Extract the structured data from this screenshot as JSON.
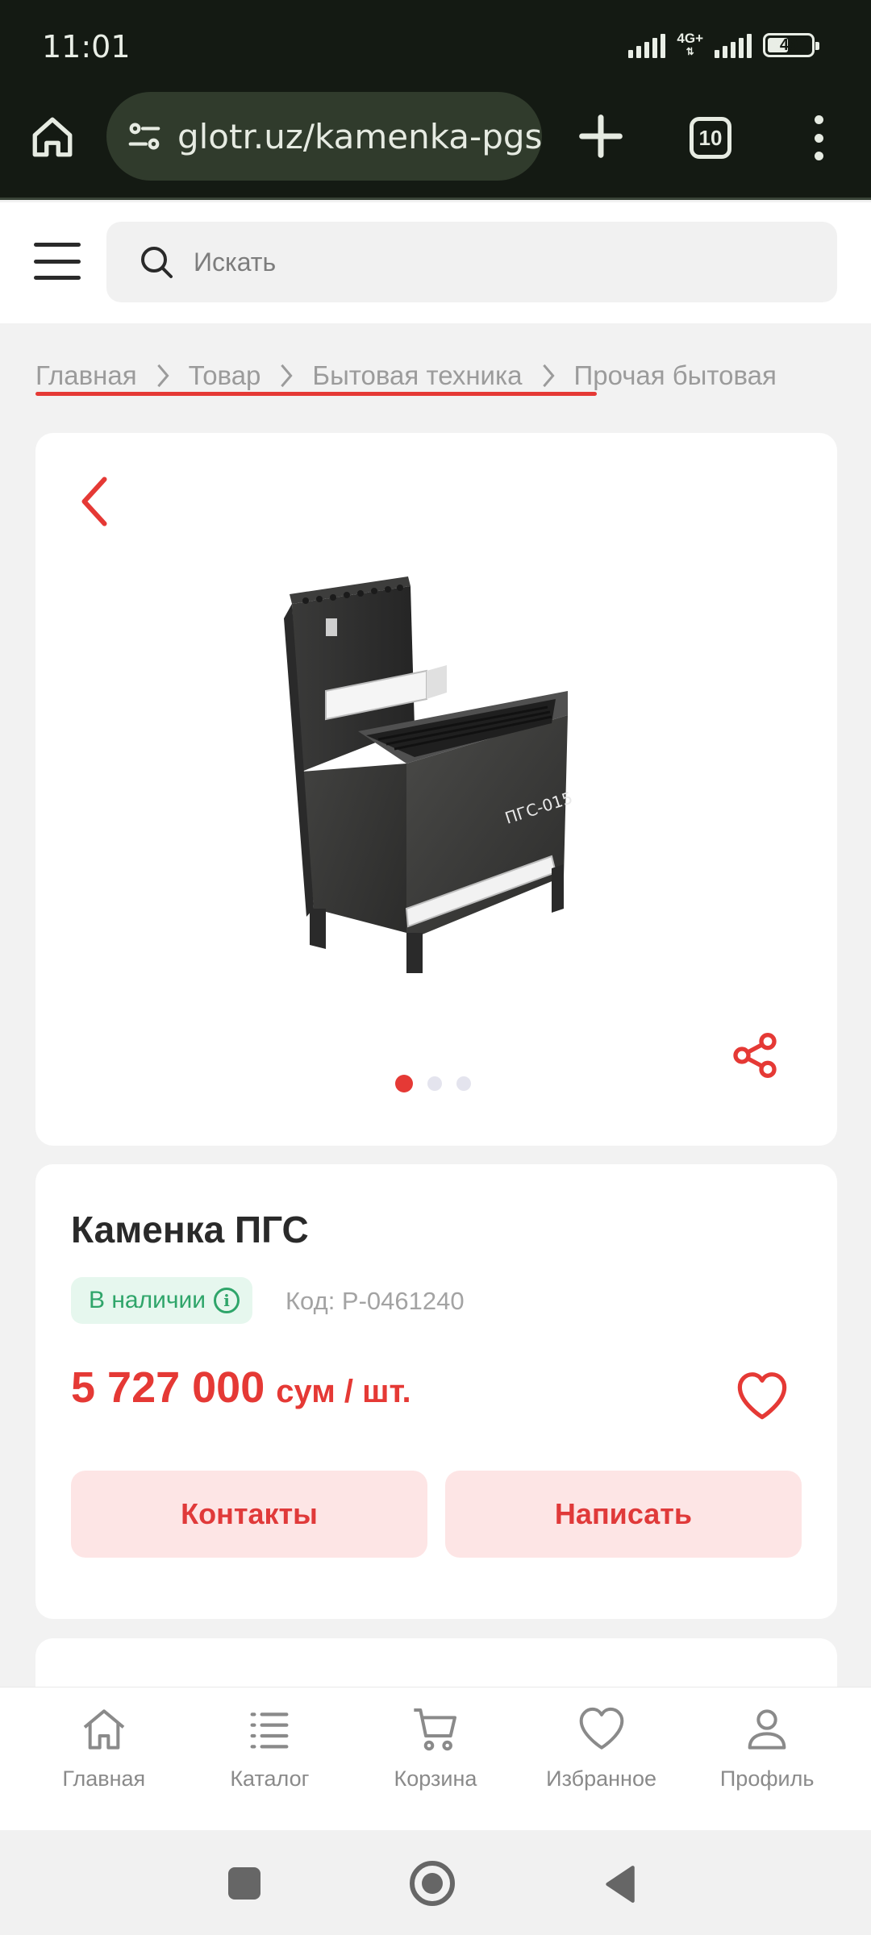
{
  "status_bar": {
    "time": "11:01",
    "network": "4G+",
    "battery_percent": 49
  },
  "browser": {
    "url": "glotr.uz/kamenka-pgs",
    "tab_count": "10"
  },
  "header": {
    "search_placeholder": "Искать"
  },
  "breadcrumb": [
    "Главная",
    "Товар",
    "Бытовая техника",
    "Прочая бытовая"
  ],
  "gallery": {
    "image_count": 3,
    "active_index": 0,
    "image_label": "ПГС-015"
  },
  "product": {
    "title": "Каменка ПГС",
    "stock": "В наличии",
    "sku": "Код: P-0461240",
    "price": "5 727 000",
    "price_unit": "сум / шт.",
    "contacts_button": "Контакты",
    "write_button": "Написать"
  },
  "bottom_nav": [
    {
      "label": "Главная",
      "icon": "home-icon"
    },
    {
      "label": "Каталог",
      "icon": "catalog-icon"
    },
    {
      "label": "Корзина",
      "icon": "cart-icon"
    },
    {
      "label": "Избранное",
      "icon": "heart-icon"
    },
    {
      "label": "Профиль",
      "icon": "profile-icon"
    }
  ],
  "colors": {
    "accent": "#e53935",
    "stock_green": "#2fa56a",
    "browser_bar": "#141a13"
  }
}
